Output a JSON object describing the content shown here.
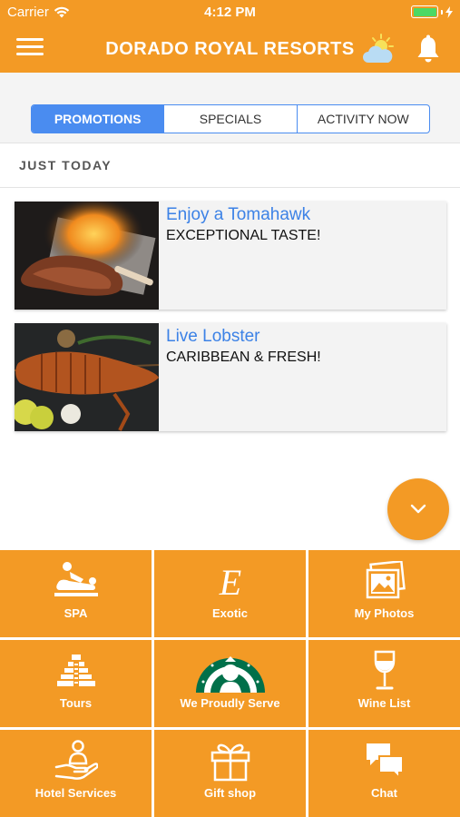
{
  "status": {
    "carrier": "Carrier",
    "time": "4:12 PM"
  },
  "header": {
    "title": "DORADO ROYAL RESORTS"
  },
  "tabs": [
    {
      "label": "PROMOTIONS"
    },
    {
      "label": "SPECIALS"
    },
    {
      "label": "ACTIVITY NOW"
    }
  ],
  "section": {
    "title": "JUST TODAY"
  },
  "promos": [
    {
      "title": "Enjoy a Tomahawk",
      "subtitle": "EXCEPTIONAL TASTE!"
    },
    {
      "title": "Live Lobster",
      "subtitle": "CARIBBEAN & FRESH!"
    }
  ],
  "menu": [
    {
      "label": "SPA",
      "icon": "spa-icon"
    },
    {
      "label": "Exotic",
      "icon": "exotic-icon"
    },
    {
      "label": "My Photos",
      "icon": "photos-icon"
    },
    {
      "label": "Tours",
      "icon": "pyramid-icon"
    },
    {
      "label": "We Proudly Serve",
      "icon": "starbucks-icon"
    },
    {
      "label": "Wine List",
      "icon": "wine-glass-icon"
    },
    {
      "label": "Hotel Services",
      "icon": "hotel-services-icon"
    },
    {
      "label": "Gift shop",
      "icon": "gift-icon"
    },
    {
      "label": "Chat",
      "icon": "chat-icon"
    }
  ],
  "colors": {
    "accent": "#f39a25",
    "tab_active": "#4a8cf0",
    "promo_title": "#3c82e6",
    "battery": "#4cd964"
  }
}
